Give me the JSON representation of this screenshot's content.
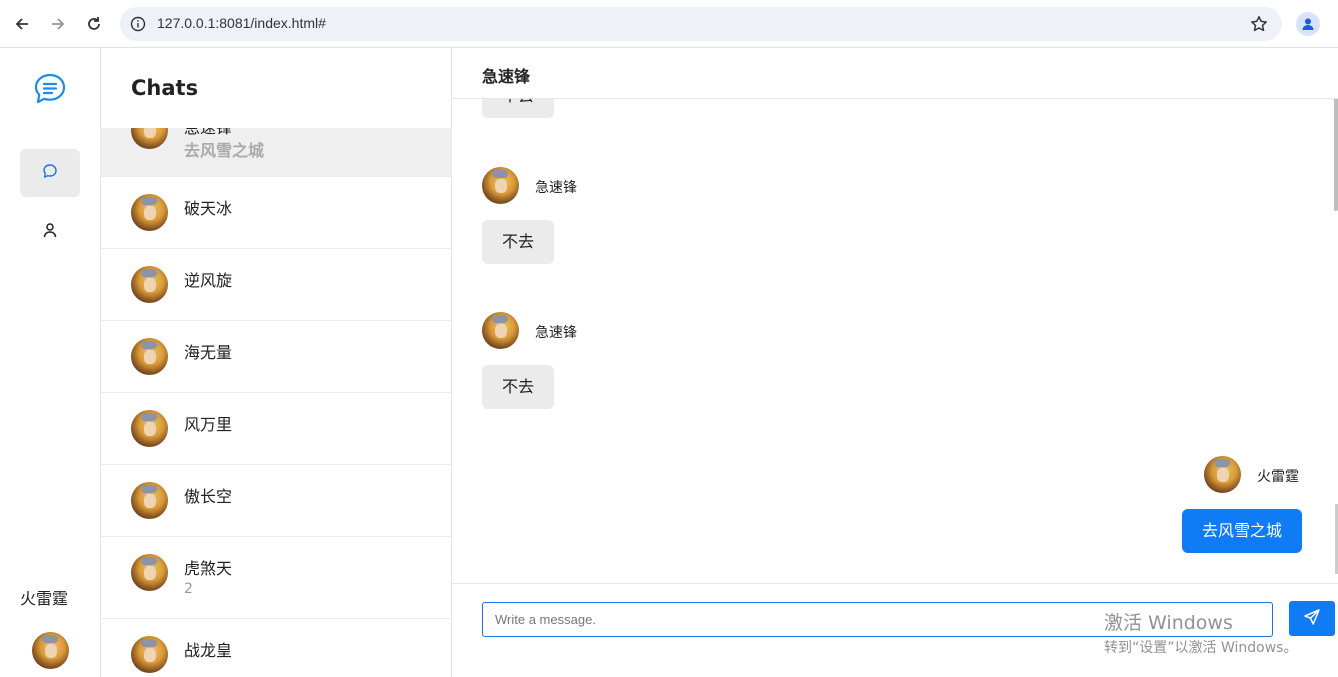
{
  "browser": {
    "url": "127.0.0.1:8081/index.html#",
    "icons": [
      "back-icon",
      "forward-icon",
      "reload-icon",
      "info-icon",
      "star-icon",
      "profile-icon"
    ]
  },
  "sidebar": {
    "icons": [
      "chat-logo-icon",
      "chat-bubble-icon",
      "user-icon"
    ],
    "current_user": "火雷霆"
  },
  "chat_list": {
    "title": "Chats",
    "items": [
      {
        "name": "急速锋",
        "preview": "去风雪之城"
      },
      {
        "name": "破天冰",
        "preview": ""
      },
      {
        "name": "逆风旋",
        "preview": ""
      },
      {
        "name": "海无量",
        "preview": ""
      },
      {
        "name": "风万里",
        "preview": ""
      },
      {
        "name": "傲长空",
        "preview": ""
      },
      {
        "name": "虎煞天",
        "preview": "2"
      },
      {
        "name": "战龙皇",
        "preview": ""
      }
    ]
  },
  "conversation": {
    "peer": "急速锋",
    "partial_top_message": "不去",
    "messages": [
      {
        "sender": "急速锋",
        "text": "不去",
        "mine": false
      },
      {
        "sender": "急速锋",
        "text": "不去",
        "mine": false
      },
      {
        "sender": "火雷霆",
        "text": "去风雪之城",
        "mine": true
      }
    ],
    "input_placeholder": "Write a message.",
    "accent": "#0f7bf5"
  },
  "watermark": {
    "line1": "激活 Windows",
    "line2": "转到“设置”以激活 Windows。"
  }
}
